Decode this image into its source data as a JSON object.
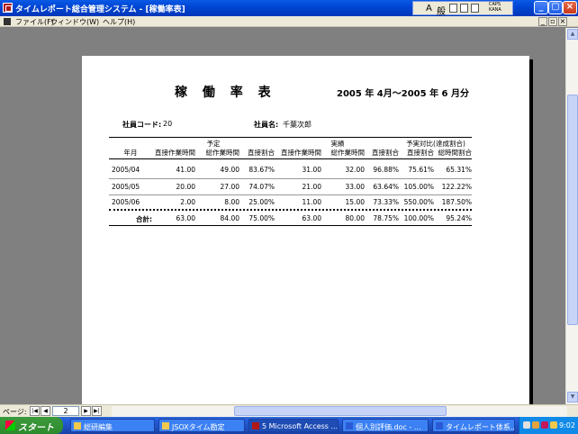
{
  "window": {
    "title": "タイムレポート総合管理システム - [稼働率表]"
  },
  "ime_toolbar": {
    "mode_label": "A",
    "kana_label": "般",
    "caps_line1": "CAPS",
    "caps_line2": "KANA"
  },
  "menu": {
    "items": [
      "ファイル(F)",
      "ウィンドウ(W)",
      "ヘルプ(H)"
    ]
  },
  "report": {
    "title": "稼 働 率 表",
    "period": "2005 年  4月～2005 年  6 月分",
    "employee_code_label": "社員コード:",
    "employee_code_value": "20",
    "employee_name_label": "社員名:",
    "employee_name_value": "千葉次郎",
    "group_headers": {
      "plan": "予定",
      "actual": "実績",
      "comparison": "予実対比(達成割合)"
    },
    "columns": [
      "年月",
      "直接作業時間",
      "総作業時間",
      "直接割合",
      "直接作業時間",
      "総作業時間",
      "直接割合",
      "直接割合",
      "総時間割合"
    ],
    "rows": [
      [
        "2005/04",
        "41.00",
        "49.00",
        "83.67%",
        "31.00",
        "32.00",
        "96.88%",
        "75.61%",
        "65.31%"
      ],
      [
        "2005/05",
        "20.00",
        "27.00",
        "74.07%",
        "21.00",
        "33.00",
        "63.64%",
        "105.00%",
        "122.22%"
      ],
      [
        "2005/06",
        "2.00",
        "8.00",
        "25.00%",
        "11.00",
        "15.00",
        "73.33%",
        "550.00%",
        "187.50%"
      ]
    ],
    "total": [
      "合計:",
      "63.00",
      "84.00",
      "75.00%",
      "63.00",
      "80.00",
      "78.75%",
      "100.00%",
      "95.24%"
    ]
  },
  "navigation": {
    "page_label": "ページ:",
    "page_value": "2"
  },
  "taskbar": {
    "start_label": "スタート",
    "tasks": [
      {
        "label": "総研編集",
        "active": false
      },
      {
        "label": "JSOXタイム勘定",
        "active": false
      },
      {
        "label": "5 Microsoft Access ...",
        "active": true
      },
      {
        "label": "個人別評価.doc - ...",
        "active": false
      },
      {
        "label": "タイムレポート体系...",
        "active": false
      }
    ],
    "clock": "9:02"
  },
  "colors": {
    "titlebar": "#0046d5",
    "chrome": "#ece9d8",
    "workspace": "#808080",
    "taskbar": "#245edb",
    "start": "#3c9a3c"
  }
}
